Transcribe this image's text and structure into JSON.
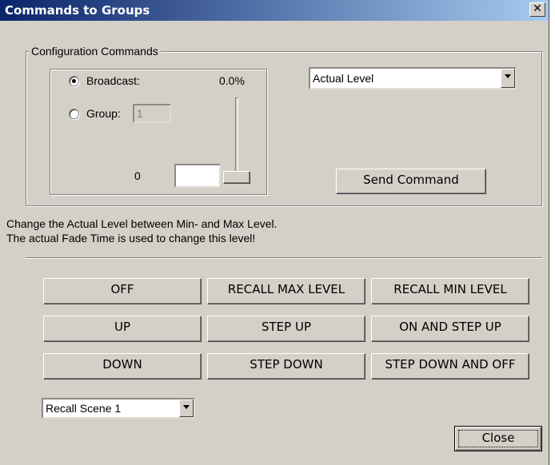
{
  "window": {
    "title": "Commands to Groups",
    "close_glyph": "✕"
  },
  "config": {
    "legend": "Configuration Commands",
    "broadcast_label": "Broadcast:",
    "broadcast_checked": true,
    "group_label": "Group:",
    "group_value": "1",
    "percent": "0.0%",
    "min_value": "0",
    "value_input": "",
    "slider_level": 0,
    "command_select": "Actual Level",
    "send_label": "Send Command"
  },
  "description": {
    "line1": "Change the Actual Level between Min- and Max Level.",
    "line2": "The actual Fade Time is used to change this level!"
  },
  "buttons": {
    "off": "OFF",
    "recall_max": "RECALL MAX LEVEL",
    "recall_min": "RECALL MIN LEVEL",
    "up": "UP",
    "step_up": "STEP UP",
    "on_step_up": "ON AND STEP UP",
    "down": "DOWN",
    "step_down": "STEP DOWN",
    "step_down_off": "STEP DOWN AND OFF"
  },
  "scene_select": "Recall Scene 1",
  "close_label": "Close"
}
